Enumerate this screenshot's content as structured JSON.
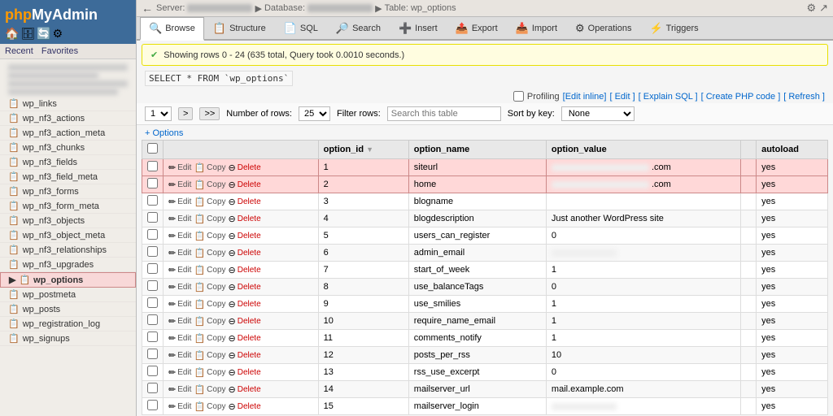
{
  "sidebar": {
    "logo": "phpMyAdmin",
    "logo_highlight": "php",
    "nav": {
      "recent": "Recent",
      "favorites": "Favorites"
    },
    "items": [
      {
        "label": "wp_links",
        "active": false
      },
      {
        "label": "wp_nf3_actions",
        "active": false
      },
      {
        "label": "wp_nf3_action_meta",
        "active": false
      },
      {
        "label": "wp_nf3_chunks",
        "active": false
      },
      {
        "label": "wp_nf3_fields",
        "active": false
      },
      {
        "label": "wp_nf3_field_meta",
        "active": false
      },
      {
        "label": "wp_nf3_forms",
        "active": false
      },
      {
        "label": "wp_nf3_form_meta",
        "active": false
      },
      {
        "label": "wp_nf3_objects",
        "active": false
      },
      {
        "label": "wp_nf3_object_meta",
        "active": false
      },
      {
        "label": "wp_nf3_relationships",
        "active": false
      },
      {
        "label": "wp_nf3_upgrades",
        "active": false
      },
      {
        "label": "wp_options",
        "active": true
      },
      {
        "label": "wp_postmeta",
        "active": false
      },
      {
        "label": "wp_posts",
        "active": false
      },
      {
        "label": "wp_registration_log",
        "active": false
      },
      {
        "label": "wp_signups",
        "active": false
      }
    ]
  },
  "topbar": {
    "server_label": "Server:",
    "database_label": "Database:",
    "table_label": "Table: wp_options",
    "settings_icon": "⚙",
    "back_icon": "←"
  },
  "tabs": [
    {
      "label": "Browse",
      "icon": "🔍",
      "active": true
    },
    {
      "label": "Structure",
      "icon": "📋",
      "active": false
    },
    {
      "label": "SQL",
      "icon": "📄",
      "active": false
    },
    {
      "label": "Search",
      "icon": "🔎",
      "active": false
    },
    {
      "label": "Insert",
      "icon": "➕",
      "active": false
    },
    {
      "label": "Export",
      "icon": "📤",
      "active": false
    },
    {
      "label": "Import",
      "icon": "📥",
      "active": false
    },
    {
      "label": "Operations",
      "icon": "⚙",
      "active": false
    },
    {
      "label": "Triggers",
      "icon": "⚡",
      "active": false
    }
  ],
  "infobar": {
    "message": "Showing rows 0 - 24  (635 total, Query took 0.0010 seconds.)"
  },
  "sql": {
    "code": "SELECT * FROM `wp_options`"
  },
  "profiling": {
    "checkbox_label": "Profiling",
    "edit_inline": "[Edit inline]",
    "edit": "[ Edit ]",
    "explain_sql": "[ Explain SQL ]",
    "create_php": "[ Create PHP code ]",
    "refresh": "[ Refresh ]"
  },
  "controls": {
    "page": "1",
    "forward": ">",
    "forward_end": ">>",
    "rows_label": "Number of rows:",
    "rows_value": "25",
    "filter_label": "Filter rows:",
    "filter_placeholder": "Search this table",
    "sort_label": "Sort by key:",
    "sort_value": "None",
    "options_label": "+ Options"
  },
  "table": {
    "columns": [
      "",
      "",
      "option_id",
      "option_name",
      "option_value",
      "",
      "autoload"
    ],
    "rows": [
      {
        "id": 1,
        "name": "siteurl",
        "value": "blurred_long",
        "autoload": "yes",
        "highlighted": true
      },
      {
        "id": 2,
        "name": "home",
        "value": "blurred_long",
        "autoload": "yes",
        "highlighted": true
      },
      {
        "id": 3,
        "name": "blogname",
        "value": "",
        "autoload": "yes",
        "highlighted": false
      },
      {
        "id": 4,
        "name": "blogdescription",
        "value": "Just another WordPress site",
        "autoload": "yes",
        "highlighted": false
      },
      {
        "id": 5,
        "name": "users_can_register",
        "value": "0",
        "autoload": "yes",
        "highlighted": false
      },
      {
        "id": 6,
        "name": "admin_email",
        "value": "blurred_email",
        "autoload": "yes",
        "highlighted": false
      },
      {
        "id": 7,
        "name": "start_of_week",
        "value": "1",
        "autoload": "yes",
        "highlighted": false
      },
      {
        "id": 8,
        "name": "use_balanceTags",
        "value": "0",
        "autoload": "yes",
        "highlighted": false
      },
      {
        "id": 9,
        "name": "use_smilies",
        "value": "1",
        "autoload": "yes",
        "highlighted": false
      },
      {
        "id": 10,
        "name": "require_name_email",
        "value": "1",
        "autoload": "yes",
        "highlighted": false
      },
      {
        "id": 11,
        "name": "comments_notify",
        "value": "1",
        "autoload": "yes",
        "highlighted": false
      },
      {
        "id": 12,
        "name": "posts_per_rss",
        "value": "10",
        "autoload": "yes",
        "highlighted": false
      },
      {
        "id": 13,
        "name": "rss_use_excerpt",
        "value": "0",
        "autoload": "yes",
        "highlighted": false
      },
      {
        "id": 14,
        "name": "mailserver_url",
        "value": "mail.example.com",
        "autoload": "yes",
        "highlighted": false
      },
      {
        "id": 15,
        "name": "mailserver_login",
        "value": "blurred_email2",
        "autoload": "yes",
        "highlighted": false
      }
    ],
    "action_edit": "Edit",
    "action_copy": "Copy",
    "action_delete": "Delete"
  }
}
